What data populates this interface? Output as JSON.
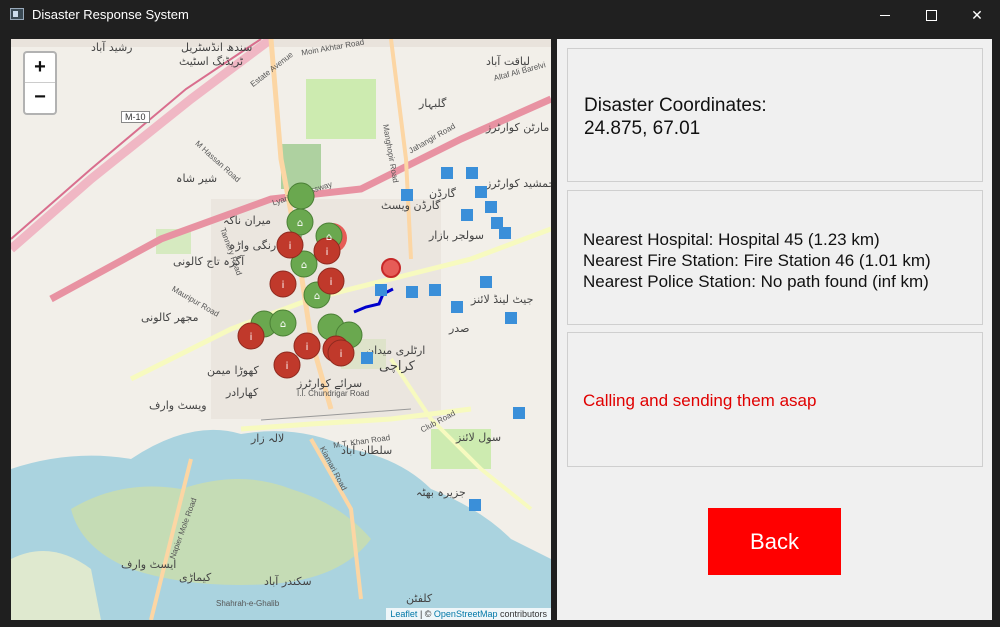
{
  "window": {
    "title": "Disaster Response System"
  },
  "map": {
    "zoom_in": "+",
    "zoom_out": "−",
    "attribution": {
      "leaflet": "Leaflet",
      "sep": " | © ",
      "osm": "OpenStreetMap",
      "contributors": " contributors"
    },
    "highway_shield": "M-10",
    "labels": [
      "رشید آباد",
      "سندھ انڈسٹریل",
      "ٹریڈنگ اسٹیٹ",
      "لیاقت آباد",
      "گلبہار",
      "مارٹن کوارٹرز",
      "جمشید کوارٹرز",
      "شیر شاہ",
      "میران ناکہ",
      "رنگی واڑہ",
      "آگرہ تاج کالونی",
      "مجھر کالونی",
      "کھوڑا میمن",
      "کھارادر",
      "ویسٹ وارف",
      "گارڈن",
      "گارڈن ویسٹ",
      "سولجر بازار",
      "صدر",
      "ارٹلری میدان",
      "کراچی",
      "سرائے کوارٹرز",
      "لالہ زار",
      "سلطان آباد",
      "سول لائنز",
      "جیٹ لینڈ لائنز",
      "کیماڑی",
      "ایسٹ وارف",
      "جزیرہ بھٹہ",
      "سکندر آباد",
      "کلفٹن"
    ],
    "roads": [
      "Moin Akhtar Road",
      "Altaf Ali Barelvi",
      "Estate Avenue",
      "M Hassan Road",
      "Jahangir Road",
      "Tannery Road",
      "Mauripur Road",
      "I.I. Chundrigar Road",
      "Club Road",
      "M.T. Khan Road",
      "Kiamari Road",
      "Napier Mole Road",
      "Shahrah-e-Ghalib",
      "Manghopir Road",
      "Lyari Expressway"
    ],
    "colors": {
      "hospital_marker": "#c0392b",
      "fire_marker": "#6aa84f",
      "police_marker": "#3a8fd9",
      "disaster_circle": "#e53935",
      "route": "#0000cc"
    }
  },
  "info": {
    "coords_heading": "Disaster Coordinates:",
    "coords_value": "24.875, 67.01",
    "nearest_hospital": "Nearest Hospital: Hospital 45 (1.23 km)",
    "nearest_fire": "Nearest Fire Station: Fire Station 46 (1.01 km)",
    "nearest_police": "Nearest Police Station: No path found (inf km)",
    "status": "Calling and sending them asap",
    "back_label": "Back"
  }
}
